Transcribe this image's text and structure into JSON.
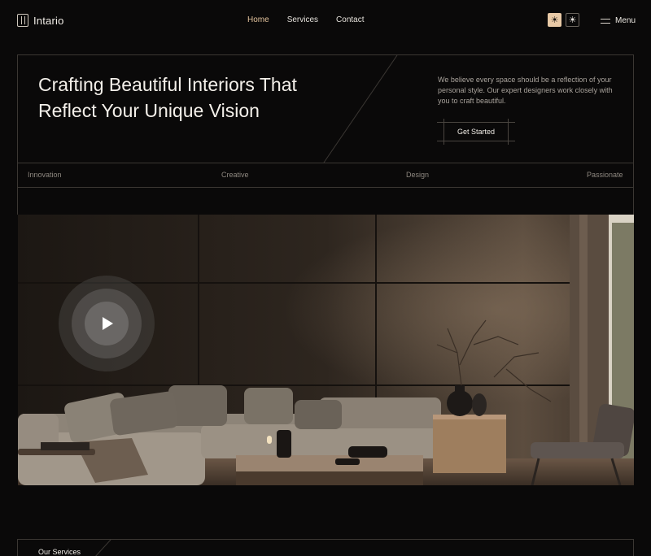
{
  "brand": {
    "name": "Intario"
  },
  "nav": {
    "links": [
      {
        "label": "Home",
        "active": true
      },
      {
        "label": "Services",
        "active": false
      },
      {
        "label": "Contact",
        "active": false
      }
    ],
    "theme_light_icon": "sun-icon",
    "theme_dark_icon": "sun-outline-icon",
    "menu_label": "Menu"
  },
  "hero": {
    "title": "Crafting Beautiful Interiors That Reflect Your Unique Vision",
    "description": "We believe every space should be a reflection of your personal style. Our expert designers work closely with you to craft beautiful.",
    "cta_label": "Get Started",
    "tags": [
      "Innovation",
      "Creative",
      "Design",
      "Passionate"
    ]
  },
  "media": {
    "play_icon": "play-icon"
  },
  "services": {
    "label": "Our Services"
  },
  "colors": {
    "background": "#0a0909",
    "accent": "#e3c39d",
    "border": "#3b3733"
  }
}
